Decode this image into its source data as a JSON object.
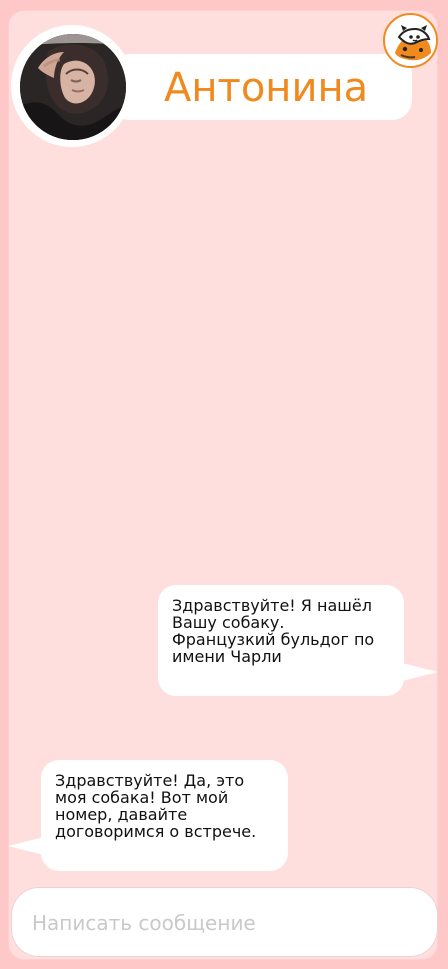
{
  "contact": {
    "name": "Антонина"
  },
  "messages": [
    {
      "from": "me",
      "text": "Здравствуйте! Я нашёл Вашу собаку. Французкий бульдог по имени Чарли"
    },
    {
      "from": "contact",
      "text": "Здравствуйте! Да, это моя собака! Вот мой номер, давайте договоримся о встрече."
    }
  ],
  "composer": {
    "placeholder": "Написать сообщение",
    "value": ""
  },
  "colors": {
    "background": "#ffc8c8",
    "panel": "#ffdede",
    "accent": "#f08a1f",
    "bubble": "#ffffff"
  },
  "icons": {
    "avatar": "contact-photo",
    "logo": "dog-cat-logo-icon"
  }
}
